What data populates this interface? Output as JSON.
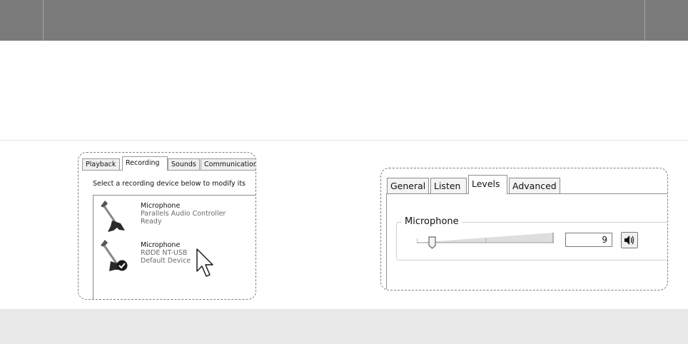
{
  "recording_panel": {
    "tabs": [
      {
        "label": "Playback"
      },
      {
        "label": "Recording"
      },
      {
        "label": "Sounds"
      },
      {
        "label": "Communications"
      }
    ],
    "instruction": "Select a recording device below to modify its",
    "devices": [
      {
        "name": "Microphone",
        "controller": "Parallels Audio Controller",
        "status": "Ready",
        "is_default": false
      },
      {
        "name": "Microphone",
        "controller": "RØDE NT-USB",
        "status": "Default Device",
        "is_default": true
      }
    ]
  },
  "levels_panel": {
    "tabs": [
      {
        "label": "General"
      },
      {
        "label": "Listen"
      },
      {
        "label": "Levels"
      },
      {
        "label": "Advanced"
      }
    ],
    "active_tab": "Levels",
    "group_label": "Microphone",
    "level_value": "9",
    "level_fraction": 0.09
  },
  "icons": {
    "device": "microphone-icon",
    "default_badge": "checkmark-icon",
    "pointer": "mouse-cursor-icon",
    "mute_toggle": "speaker-icon"
  }
}
